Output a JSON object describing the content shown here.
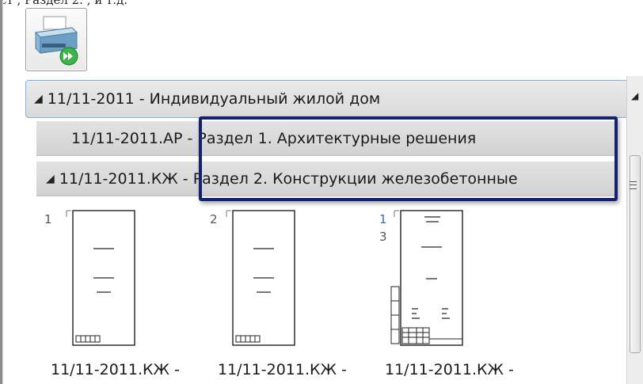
{
  "caption": "ст , Раздел 2. , и т.д.",
  "toolbar": {
    "print_button_icon": "printer-icon"
  },
  "group": {
    "title": "11/11-2011 - Индивидуальный жилой дом",
    "expanded": true
  },
  "sections": [
    {
      "code": "11/11-2011.АР",
      "sep": " - ",
      "title": "Раздел 1. Архитектурные решения",
      "expanded": false
    },
    {
      "code": "11/11-2011.КЖ",
      "sep": " - ",
      "title": "Раздел 2. Конструкции железобетонные",
      "expanded": true
    }
  ],
  "thumbnails": [
    {
      "number": "1",
      "number2": "",
      "label": "11/11-2011.КЖ -"
    },
    {
      "number": "2",
      "number2": "",
      "label": "11/11-2011.КЖ -"
    },
    {
      "number": "1",
      "number2": "3",
      "label": "11/11-2011.КЖ -"
    }
  ],
  "colors": {
    "highlight": "#15206e",
    "header_border": "#7eb4ea",
    "selected_number": "#2e6fbf"
  }
}
